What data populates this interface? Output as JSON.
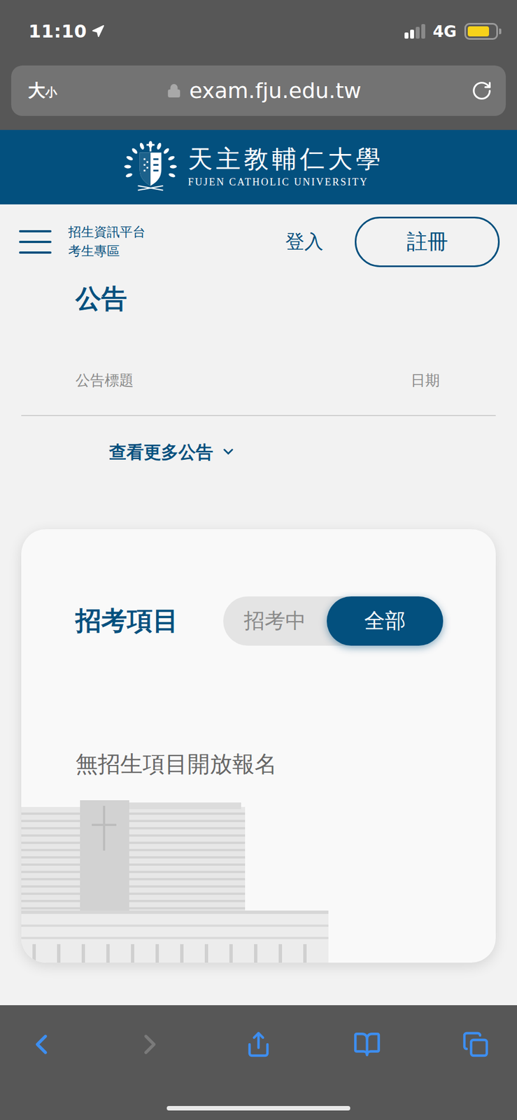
{
  "status_bar": {
    "time": "11:10",
    "location_active": true,
    "signal_level": 0.5,
    "network": "4G",
    "battery_level": 0.8,
    "low_power_mode": true
  },
  "address_bar": {
    "text_size": "大小",
    "url": "exam.fju.edu.tw",
    "secure": true
  },
  "site_header": {
    "title": "天主教輔仁大學",
    "subtitle": "FUJEN CATHOLIC UNIVERSITY"
  },
  "nav": {
    "platform": [
      "招生資訊平台",
      "考生專區"
    ],
    "login": "登入",
    "register": "註冊"
  },
  "announcements": {
    "title": "公告",
    "columns": [
      "公告標題",
      "日期"
    ],
    "more": "查看更多公告"
  },
  "exams": {
    "title": "招考項目",
    "filters": [
      {
        "label": "招考中",
        "selected": false
      },
      {
        "label": "全部",
        "selected": true
      }
    ],
    "empty": "無招生項目開放報名"
  },
  "toolbar": {
    "buttons": [
      {
        "kind": "back",
        "disabled": false
      },
      {
        "kind": "forward",
        "disabled": true
      },
      {
        "kind": "share",
        "disabled": false
      },
      {
        "kind": "bookmarks",
        "disabled": false
      },
      {
        "kind": "tabs",
        "disabled": false
      }
    ]
  }
}
